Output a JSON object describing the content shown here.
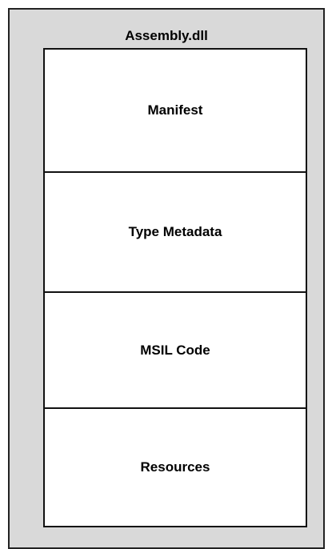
{
  "diagram": {
    "title": "Assembly.dll",
    "sections": [
      {
        "label": "Manifest"
      },
      {
        "label": "Type Metadata"
      },
      {
        "label": "MSIL Code"
      },
      {
        "label": "Resources"
      }
    ]
  },
  "colors": {
    "background": "#d9d9d9",
    "section_fill": "#ffffff",
    "stroke": "#111111",
    "text": "#000000"
  }
}
